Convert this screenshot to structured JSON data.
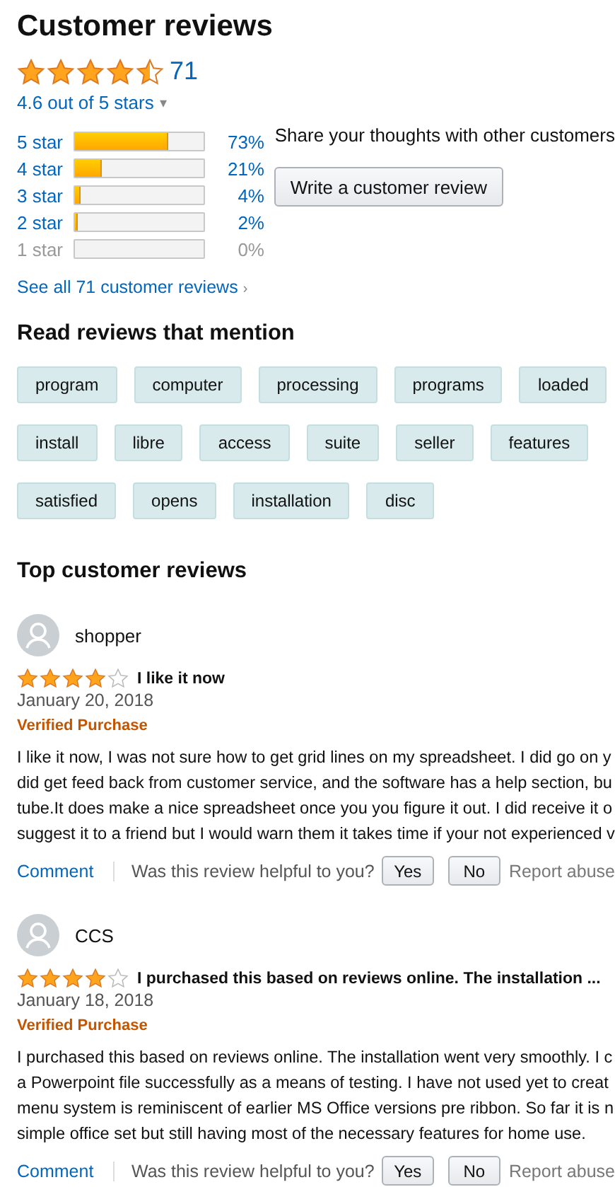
{
  "title": "Customer reviews",
  "summary": {
    "stars": 4.5,
    "count": "71",
    "average": "4.6 out of 5 stars",
    "dropdown": "▾"
  },
  "histogram": [
    {
      "label": "5 star",
      "level": 0.73,
      "percent": "73%",
      "disabled": false
    },
    {
      "label": "4 star",
      "level": 0.21,
      "percent": "21%",
      "disabled": false
    },
    {
      "label": "3 star",
      "level": 0.04,
      "percent": "4%",
      "disabled": false
    },
    {
      "label": "2 star",
      "level": 0.02,
      "percent": "2%",
      "disabled": false
    },
    {
      "label": "1 star",
      "level": 0,
      "percent": "0%",
      "disabled": true
    }
  ],
  "share": {
    "text": "Share your thoughts with other customers",
    "button": "Write a customer review"
  },
  "see_all": {
    "label": "See all 71 customer reviews",
    "arrow": "›"
  },
  "mentions": {
    "heading": "Read reviews that mention",
    "tags": [
      "program",
      "computer",
      "processing",
      "programs",
      "loaded",
      "install",
      "libre",
      "access",
      "suite",
      "seller",
      "features",
      "satisfied",
      "opens",
      "installation",
      "disc"
    ]
  },
  "top_heading": "Top customer reviews",
  "reviews": [
    {
      "author": "shopper",
      "stars": 4,
      "title": "I like it now",
      "date": "January 20, 2018",
      "badge": "Verified Purchase",
      "body": [
        "I like it now, I was not sure how to get grid lines on my spreadsheet. I did go on y",
        "did get feed back from customer service, and the software has a help section, bu",
        "tube.It does make a nice spreadsheet once you you figure it out. I did receive it o",
        "suggest it to a friend but I would warn them it takes time if your not experienced v"
      ],
      "comment": "Comment",
      "helpful": "Was this review helpful to you?",
      "yes": "Yes",
      "no": "No",
      "report": "Report abuse"
    },
    {
      "author": "CCS",
      "stars": 4,
      "title": "I purchased this based on reviews online. The installation ...",
      "date": "January 18, 2018",
      "badge": "Verified Purchase",
      "body": [
        "I purchased this based on reviews online. The installation went very smoothly. I c",
        "a Powerpoint file successfully as a means of testing. I have not used yet to creat",
        "menu system is reminiscent of earlier MS Office versions pre ribbon. So far it is n",
        "simple office set but still having most of the necessary features for home use."
      ],
      "comment": "Comment",
      "helpful": "Was this review helpful to you?",
      "yes": "Yes",
      "no": "No",
      "report": "Report abuse"
    }
  ]
}
